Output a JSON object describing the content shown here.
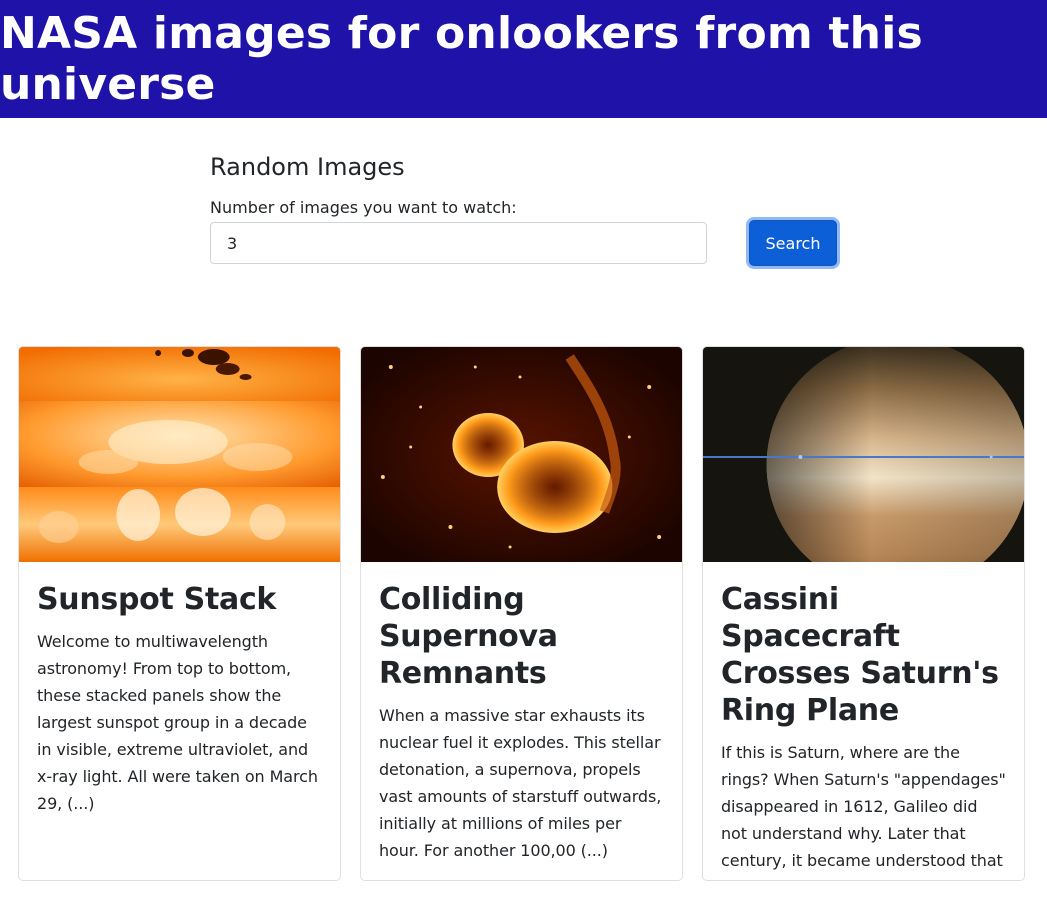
{
  "header": {
    "title": "NASA images for onlookers from this universe"
  },
  "form": {
    "title": "Random Images",
    "label": "Number of images you want to watch:",
    "input_value": "3",
    "search_label": "Search"
  },
  "cards": [
    {
      "title": "Sunspot Stack",
      "text": "Welcome to multiwavelength astronomy! From top to bottom, these stacked panels show the largest sunspot group in a decade in visible, extreme ultraviolet, and x-ray light. All were taken on March 29, (...)"
    },
    {
      "title": "Colliding Supernova Remnants",
      "text": "When a massive star exhausts its nuclear fuel it explodes. This stellar detonation, a supernova, propels vast amounts of starstuff outwards, initially at millions of miles per hour. For another 100,00 (...)"
    },
    {
      "title": "Cassini Spacecraft Crosses Saturn's Ring Plane",
      "text": "If this is Saturn, where are the rings? When Saturn's \"appendages\" disappeared in 1612, Galileo did not understand why. Later that century, it became understood that Saturn's unusual protrusions we (...)"
    }
  ],
  "colors": {
    "header_bg": "#1e12a8",
    "button_bg": "#0d5fd8"
  }
}
